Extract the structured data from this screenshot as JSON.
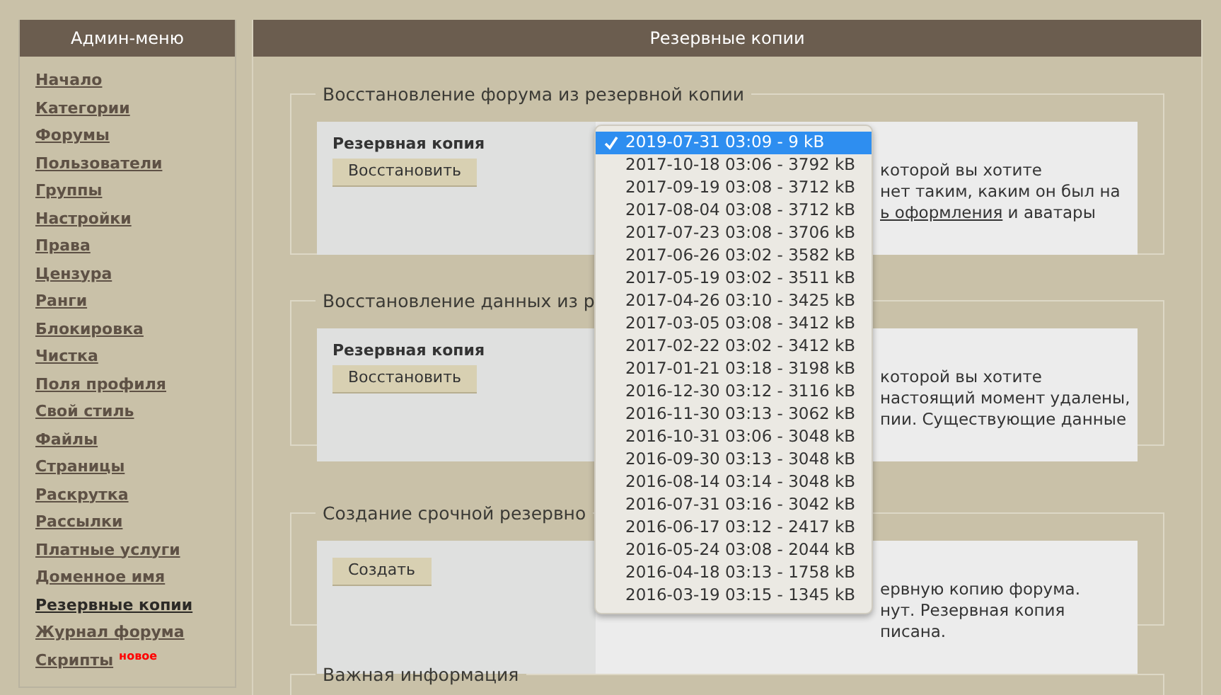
{
  "sidebar": {
    "title": "Админ-меню",
    "items": [
      {
        "label": "Начало",
        "selected": false
      },
      {
        "label": "Категории",
        "selected": false
      },
      {
        "label": "Форумы",
        "selected": false
      },
      {
        "label": "Пользователи",
        "selected": false
      },
      {
        "label": "Группы",
        "selected": false
      },
      {
        "label": "Настройки",
        "selected": false
      },
      {
        "label": "Права",
        "selected": false
      },
      {
        "label": "Цензура",
        "selected": false
      },
      {
        "label": "Ранги",
        "selected": false
      },
      {
        "label": "Блокировка",
        "selected": false
      },
      {
        "label": "Чистка",
        "selected": false
      },
      {
        "label": "Поля профиля",
        "selected": false
      },
      {
        "label": "Свой стиль",
        "selected": false
      },
      {
        "label": "Файлы",
        "selected": false
      },
      {
        "label": "Страницы",
        "selected": false
      },
      {
        "label": "Раскрутка",
        "selected": false
      },
      {
        "label": "Рассылки",
        "selected": false
      },
      {
        "label": "Платные услуги",
        "selected": false
      },
      {
        "label": "Доменное имя",
        "selected": false
      },
      {
        "label": "Резервные копии",
        "selected": true
      },
      {
        "label": "Журнал форума",
        "selected": false
      },
      {
        "label": "Скрипты",
        "selected": false,
        "badge": "новое"
      }
    ]
  },
  "main": {
    "title": "Резервные копии",
    "sections": [
      {
        "legend": "Восстановление форума из резервной копии",
        "field_label": "Резервная копия",
        "button": "Восстановить",
        "lines": [
          [
            {
              "text": "которой вы хотите",
              "kind": "text"
            }
          ],
          [
            {
              "text": "нет таким, каким он был на",
              "kind": "text"
            }
          ],
          [
            {
              "text": "ь оформления",
              "kind": "link"
            },
            {
              "text": " и аватары",
              "kind": "text"
            }
          ]
        ]
      },
      {
        "legend": "Восстановление данных из р",
        "field_label": "Резервная копия",
        "button": "Восстановить",
        "lines": [
          [
            {
              "text": "которой вы хотите",
              "kind": "text"
            }
          ],
          [
            {
              "text": "настоящий момент удалены,",
              "kind": "text"
            }
          ],
          [
            {
              "text": "пии. Существующие данные",
              "kind": "text"
            }
          ]
        ]
      },
      {
        "legend": "Создание срочной резервно",
        "button": "Создать",
        "lines": [
          [
            {
              "text": "ервную копию форума.",
              "kind": "text"
            }
          ],
          [
            {
              "text": "нут. Резервная копия",
              "kind": "text"
            }
          ],
          [
            {
              "text": "писана.",
              "kind": "text"
            }
          ]
        ]
      },
      {
        "legend": "Важная информация"
      }
    ]
  },
  "dropdown": {
    "options": [
      {
        "label": "2019-07-31 03:09 - 9 kB",
        "selected": true
      },
      {
        "label": "2017-10-18 03:06 - 3792 kB",
        "selected": false
      },
      {
        "label": "2017-09-19 03:08 - 3712 kB",
        "selected": false
      },
      {
        "label": "2017-08-04 03:08 - 3712 kB",
        "selected": false
      },
      {
        "label": "2017-07-23 03:08 - 3706 kB",
        "selected": false
      },
      {
        "label": "2017-06-26 03:02 - 3582 kB",
        "selected": false
      },
      {
        "label": "2017-05-19 03:02 - 3511 kB",
        "selected": false
      },
      {
        "label": "2017-04-26 03:10 - 3425 kB",
        "selected": false
      },
      {
        "label": "2017-03-05 03:08 - 3412 kB",
        "selected": false
      },
      {
        "label": "2017-02-22 03:02 - 3412 kB",
        "selected": false
      },
      {
        "label": "2017-01-21 03:18 - 3198 kB",
        "selected": false
      },
      {
        "label": "2016-12-30 03:12 - 3116 kB",
        "selected": false
      },
      {
        "label": "2016-11-30 03:13 - 3062 kB",
        "selected": false
      },
      {
        "label": "2016-10-31 03:06 - 3048 kB",
        "selected": false
      },
      {
        "label": "2016-09-30 03:13 - 3048 kB",
        "selected": false
      },
      {
        "label": "2016-08-14 03:14 - 3048 kB",
        "selected": false
      },
      {
        "label": "2016-07-31 03:16 - 3042 kB",
        "selected": false
      },
      {
        "label": "2016-06-17 03:12 - 2417 kB",
        "selected": false
      },
      {
        "label": "2016-05-24 03:08 - 2044 kB",
        "selected": false
      },
      {
        "label": "2016-04-18 03:13 - 1758 kB",
        "selected": false
      },
      {
        "label": "2016-03-19 03:15 - 1345 kB",
        "selected": false
      }
    ]
  }
}
